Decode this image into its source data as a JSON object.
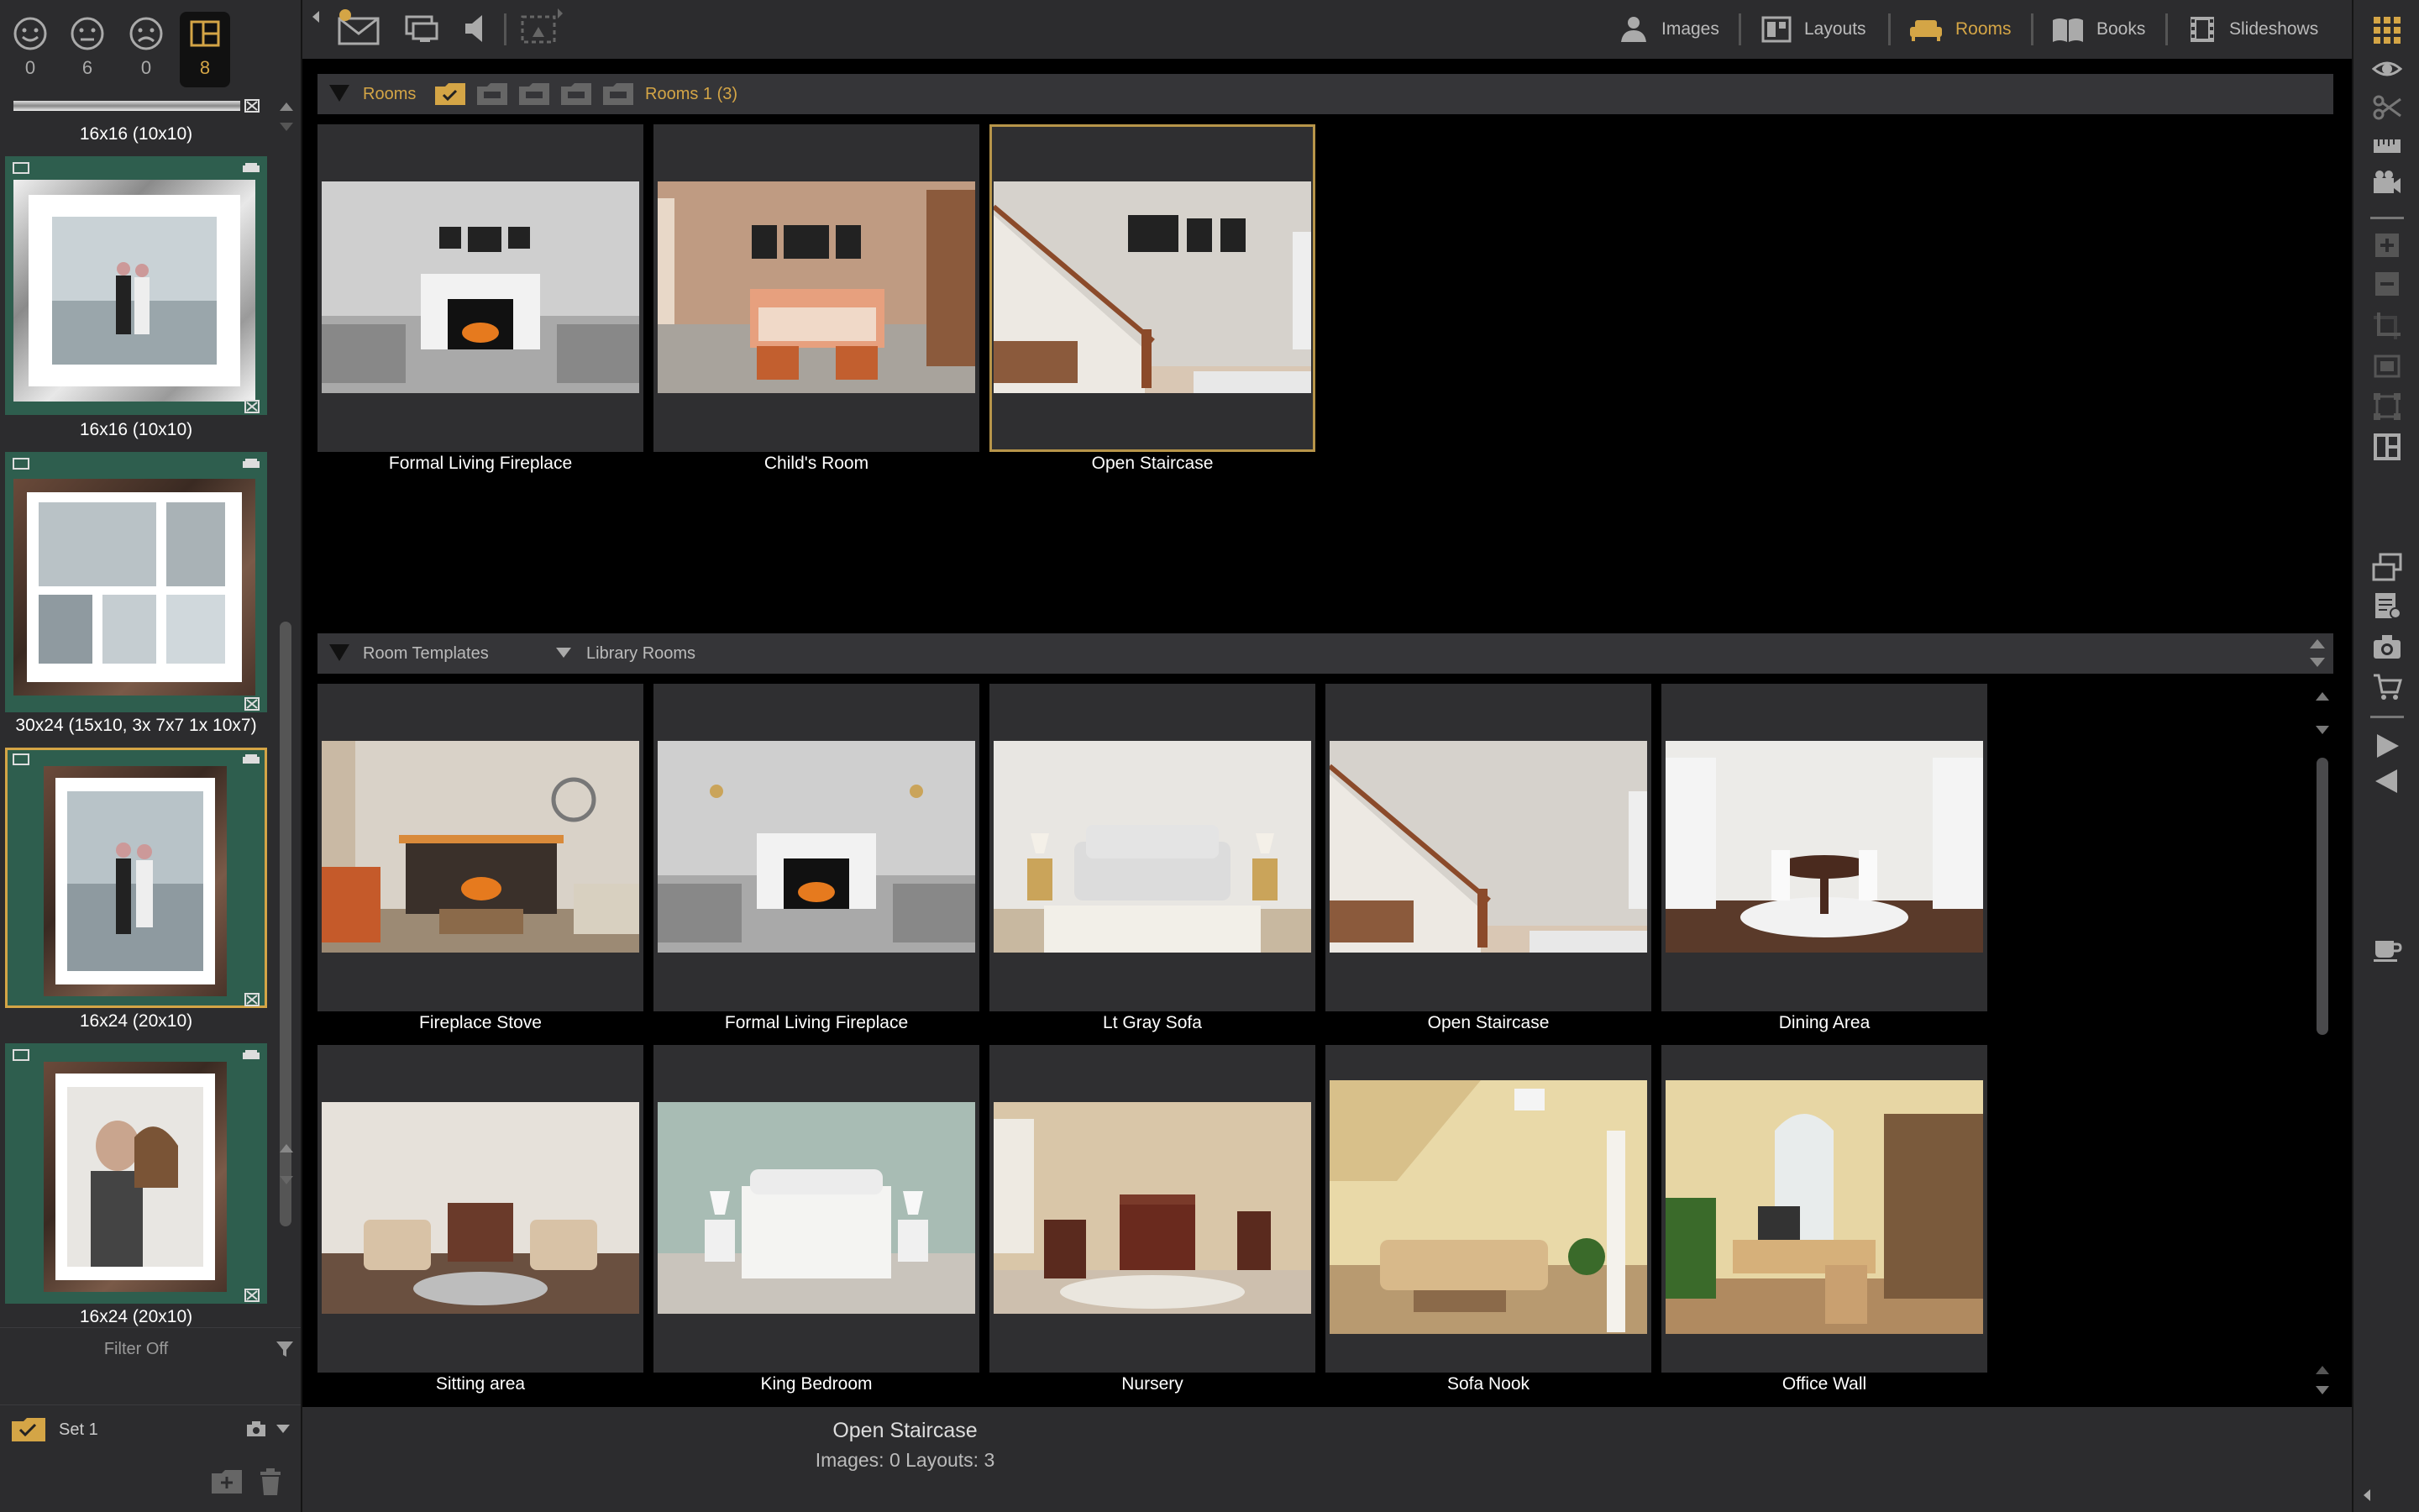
{
  "ratings": [
    {
      "icon": "happy-face-icon",
      "count": "0"
    },
    {
      "icon": "neutral-face-icon",
      "count": "6"
    },
    {
      "icon": "sad-face-icon",
      "count": "0"
    },
    {
      "icon": "layout-grid-icon",
      "count": "8"
    }
  ],
  "thumbnails": [
    {
      "label": "16x16 (10x10)"
    },
    {
      "label": "16x16 (10x10)"
    },
    {
      "label": "30x24 (15x10, 3x 7x7 1x 10x7)"
    },
    {
      "label": "16x24 (20x10)"
    },
    {
      "label": "16x24 (20x10)"
    }
  ],
  "filter": {
    "label": "Filter Off"
  },
  "set": {
    "label": "Set 1"
  },
  "modules": [
    {
      "label": "Images",
      "icon": "person-icon",
      "active": false
    },
    {
      "label": "Layouts",
      "icon": "layout-icon",
      "active": false
    },
    {
      "label": "Rooms",
      "icon": "sofa-icon",
      "active": true
    },
    {
      "label": "Books",
      "icon": "book-icon",
      "active": false
    },
    {
      "label": "Slideshows",
      "icon": "film-icon",
      "active": false
    }
  ],
  "rooms_section": {
    "title": "Rooms",
    "set_label": "Rooms 1 (3)",
    "items": [
      {
        "name": "Formal Living Fireplace"
      },
      {
        "name": "Child's Room"
      },
      {
        "name": "Open Staircase",
        "selected": true
      }
    ]
  },
  "templates_section": {
    "title": "Room Templates",
    "library_label": "Library Rooms",
    "items": [
      {
        "name": "Fireplace Stove"
      },
      {
        "name": "Formal Living Fireplace"
      },
      {
        "name": "Lt Gray Sofa"
      },
      {
        "name": "Open Staircase"
      },
      {
        "name": "Dining Area"
      },
      {
        "name": "Sitting area"
      },
      {
        "name": "King Bedroom"
      },
      {
        "name": "Nursery"
      },
      {
        "name": "Sofa Nook"
      },
      {
        "name": "Office Wall"
      }
    ]
  },
  "status": {
    "title": "Open Staircase",
    "counts": "Images: 0 Layouts: 3"
  },
  "colors": {
    "accent": "#d4a546",
    "panel": "#2c2c2e",
    "background": "#000000"
  }
}
